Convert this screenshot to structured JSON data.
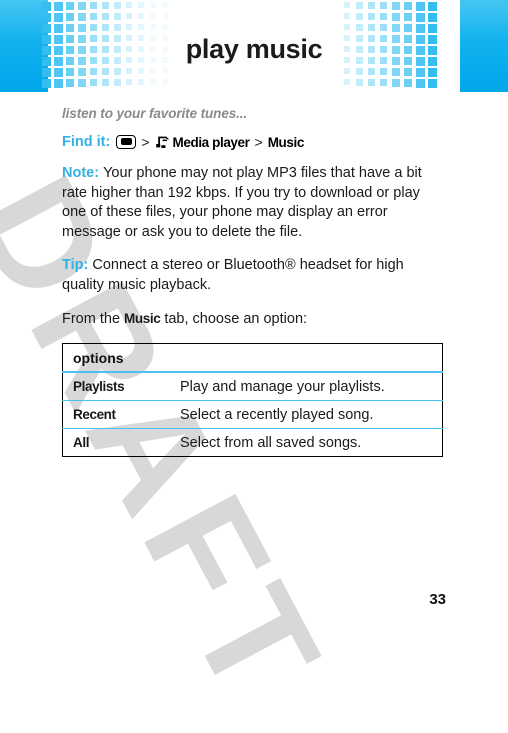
{
  "page": {
    "title": "play music",
    "number": "33",
    "watermark": "DRAFT"
  },
  "colors": {
    "accent_blue": "#33b0e5",
    "band_blue": "#00a7ea",
    "grid_square": "#33bdf0",
    "table_rule": "#4cc0ef",
    "subtitle_gray": "#8a8a8a",
    "watermark_gray": "#d8d8d8"
  },
  "content": {
    "subtitle": "listen to your favorite tunes...",
    "find_it": {
      "label": "Find it:",
      "center_key_icon": "center-key-icon",
      "separator_1": ">",
      "media_player_icon": "media-player-icon",
      "media_player_label": "Media player",
      "separator_2": ">",
      "music_label": "Music"
    },
    "note": {
      "lead": "Note:",
      "body": "Your phone may not play MP3 files that have a bit rate higher than 192 kbps. If you try to download or play one of these files, your phone may display an error message or ask you to delete the file."
    },
    "tip": {
      "lead": "Tip:",
      "body": "Connect a stereo or Bluetooth® headset for high quality music playback."
    },
    "intro": {
      "before": "From the ",
      "tab_name": "Music",
      "after": " tab, choose an option:"
    }
  },
  "table": {
    "header": "options",
    "rows": [
      {
        "name": "Playlists",
        "description": "Play and manage your playlists."
      },
      {
        "name": "Recent",
        "description": "Select a recently played song."
      },
      {
        "name": "All",
        "description": "Select from all saved songs."
      }
    ]
  }
}
